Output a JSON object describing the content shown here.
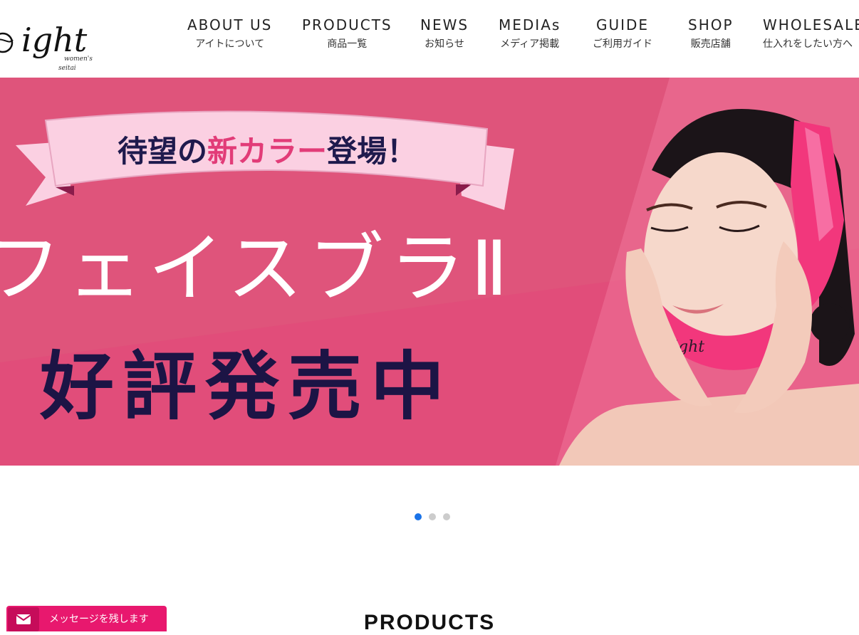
{
  "brand": {
    "logo_text": "ight",
    "logo_sub1": "women's",
    "logo_sub2": "seitai"
  },
  "nav": [
    {
      "en": "ABOUT US",
      "ja": "アイトについて"
    },
    {
      "en": "PRODUCTS",
      "ja": "商品一覧"
    },
    {
      "en": "NEWS",
      "ja": "お知らせ"
    },
    {
      "en": "MEDIAs",
      "ja": "メディア掲載"
    },
    {
      "en": "GUIDE",
      "ja": "ご利用ガイド"
    },
    {
      "en": "SHOP",
      "ja": "販売店舗"
    },
    {
      "en": "WHOLESALE",
      "ja": "仕入れをしたい方へ"
    }
  ],
  "hero": {
    "ribbon_part1": "待望の",
    "ribbon_highlight": "新カラー",
    "ribbon_part2": "登場！",
    "product_name": "フェイスブラⅡ",
    "tagline": "好評発売中",
    "band_print": "ight"
  },
  "slider": {
    "active_index": 0,
    "count": 3
  },
  "sections": {
    "products_title": "PRODUCTS"
  },
  "message_button": {
    "icon": "envelope-icon",
    "label": "メッセージを残します"
  },
  "colors": {
    "hero_bg": "#e0567d",
    "ribbon": "#fbd0e2",
    "ribbon_text": "#1f1a4d",
    "ribbon_highlight": "#e23c78",
    "tagline": "#1c1445",
    "dot_active": "#1a73e8",
    "dot_inactive": "#cccccc",
    "message_bg": "#e8186e"
  }
}
